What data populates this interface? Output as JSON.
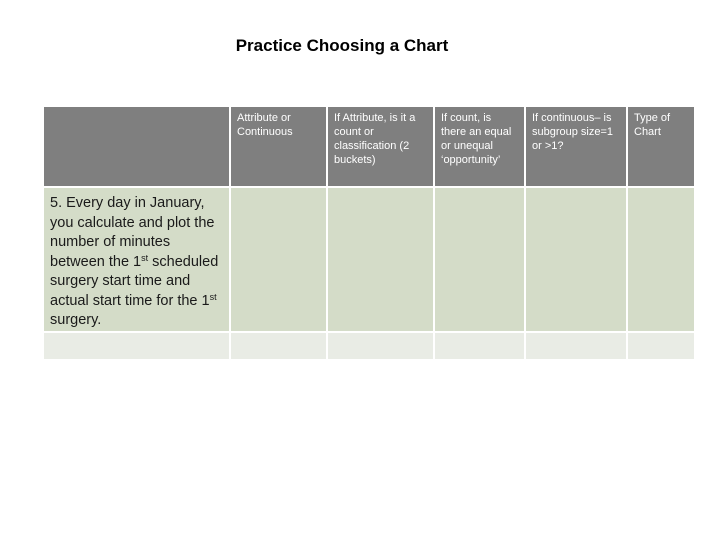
{
  "title": "Practice Choosing a Chart",
  "table": {
    "headers": [
      "",
      "Attribute or Continuous",
      "If Attribute, is it a count or classification (2 buckets)",
      "If count, is there an equal or unequal ‘opportunity’",
      "If continuous– is subgroup size=1 or >1?",
      "Type of Chart"
    ],
    "rows": [
      {
        "question": {
          "part1": "5. Every day in January, you calculate and plot the number of minutes between the 1",
          "sup1": "st",
          "part2": " scheduled surgery start time and actual start time for the 1",
          "sup2": "st",
          "part3": " surgery."
        },
        "cells": [
          "",
          "",
          "",
          "",
          ""
        ]
      },
      {
        "question": "",
        "cells": [
          "",
          "",
          "",
          "",
          ""
        ]
      }
    ]
  },
  "colors": {
    "header_bg": "#7f7f7f",
    "row1_bg": "#d4dcc8",
    "row2_bg": "#e9ece5"
  }
}
